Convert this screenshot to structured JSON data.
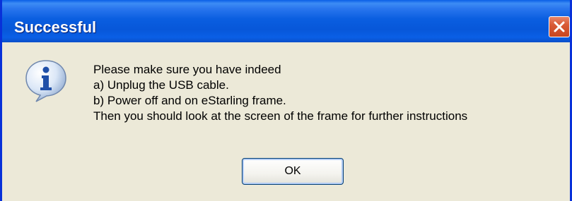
{
  "dialog": {
    "title": "Successful",
    "icon": "info-icon",
    "message_lines": [
      "Please make sure you have indeed",
      "a) Unplug the USB cable.",
      "b) Power off and on eStarling frame.",
      "Then you should look at the screen of the frame for further instructions"
    ],
    "ok_label": "OK"
  },
  "colors": {
    "titlebar": "#0a5ee0",
    "window_frame": "#0831d9",
    "window_body": "#ece9d8",
    "close_button": "#d95a36"
  }
}
